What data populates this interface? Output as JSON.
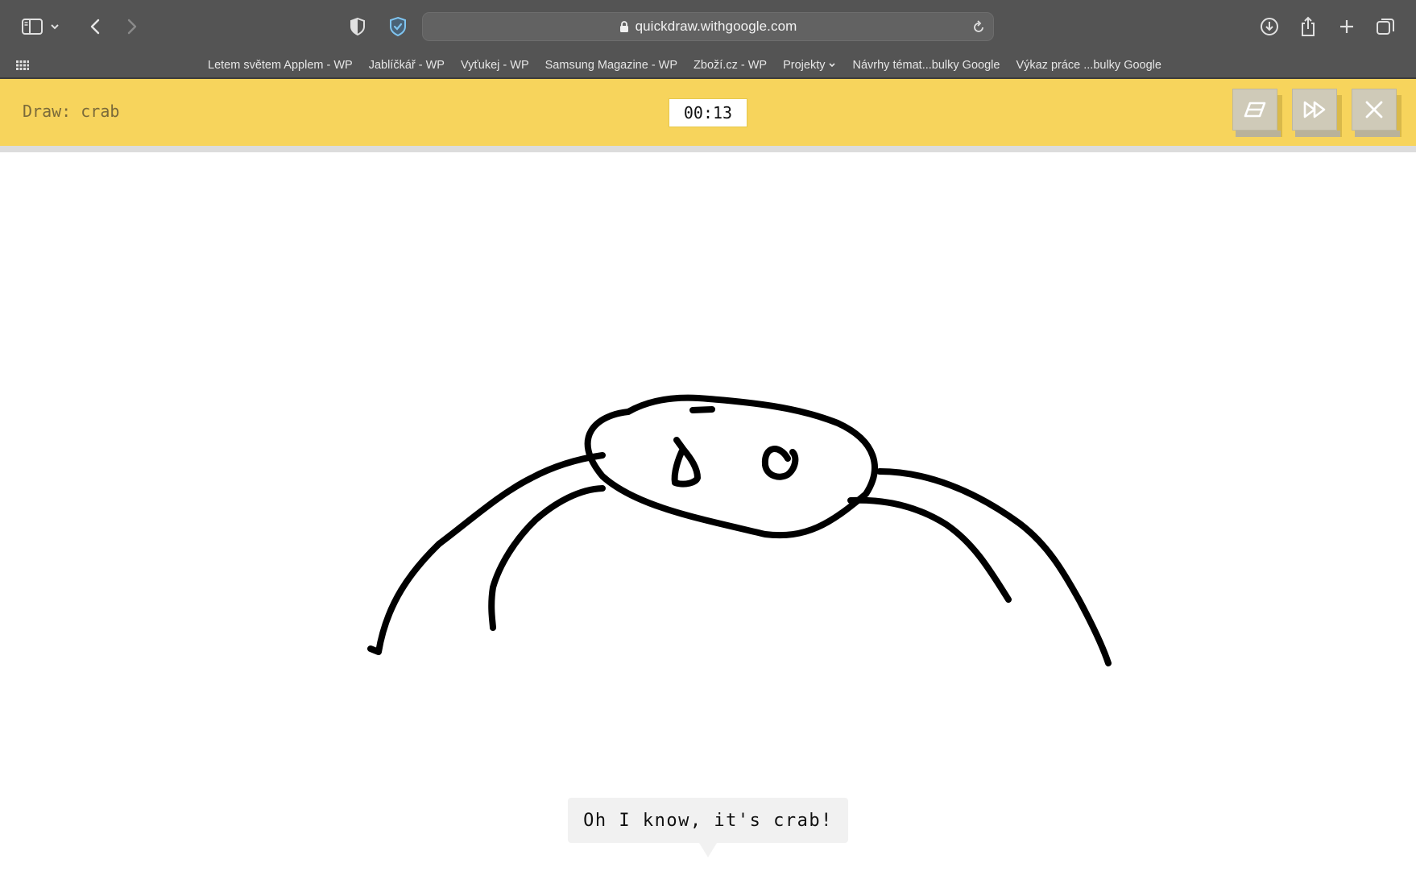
{
  "browser": {
    "url": "quickdraw.withgoogle.com",
    "bookmarks": [
      {
        "label": "Letem světem Applem - WP"
      },
      {
        "label": "Jablíčkář - WP"
      },
      {
        "label": "Vyťukej - WP"
      },
      {
        "label": "Samsung Magazine - WP"
      },
      {
        "label": "Zboží.cz - WP"
      },
      {
        "label": "Projekty",
        "has_dropdown": true
      },
      {
        "label": "Návrhy témat...bulky Google"
      },
      {
        "label": "Výkaz práce ...bulky Google"
      }
    ],
    "icons": {
      "sidebar": "sidebar-icon",
      "tab_menu": "chevron-down-icon",
      "back": "chevron-left-icon",
      "forward": "chevron-right-icon",
      "privacy": "shield-half-icon",
      "extension": "shield-check-icon",
      "lock": "lock-icon",
      "reload": "reload-icon",
      "downloads": "download-icon",
      "share": "share-icon",
      "new_tab": "plus-icon",
      "tab_overview": "tabs-icon",
      "favorites": "grid-icon"
    },
    "colors": {
      "chrome": "#545454",
      "extension_accent": "#7fc4f0"
    }
  },
  "game": {
    "prompt": "Draw: crab",
    "timer": "00:13",
    "buttons": {
      "clear": "eraser-icon",
      "skip": "fast-forward-icon",
      "close": "close-icon"
    },
    "guess_message": "Oh I know, it's crab!",
    "colors": {
      "header": "#f7d45c",
      "ink": "#000000"
    }
  }
}
